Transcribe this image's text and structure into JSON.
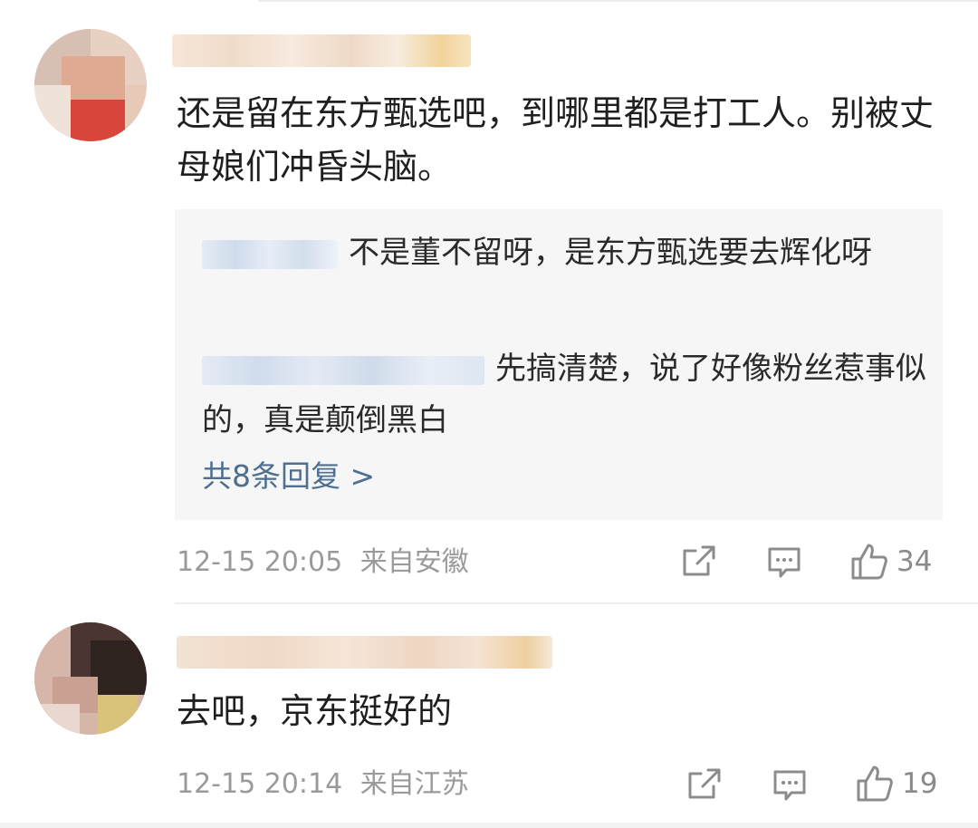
{
  "comments": [
    {
      "text": "还是留在东方甄选吧，到哪里都是打工人。别被丈母娘们冲昏头脑。",
      "replies": [
        {
          "text": "不是董不留呀，是东方甄选要去辉化呀"
        },
        {
          "text": "先搞清楚，说了好像粉丝惹事似的，真是颠倒黑白"
        }
      ],
      "more_replies": "共8条回复 >",
      "time": "12-15 20:05",
      "location": "来自安徽",
      "likes": "34",
      "icons": [
        "share-icon",
        "comment-icon",
        "like-icon"
      ]
    },
    {
      "text": "去吧，京东挺好的",
      "time": "12-15 20:14",
      "location": "来自江苏",
      "likes": "19",
      "icons": [
        "share-icon",
        "comment-icon",
        "like-icon"
      ]
    }
  ],
  "colors": {
    "link": "#4f6f91",
    "meta": "#9a9a9a",
    "reply_bg": "#f6f6f6"
  }
}
